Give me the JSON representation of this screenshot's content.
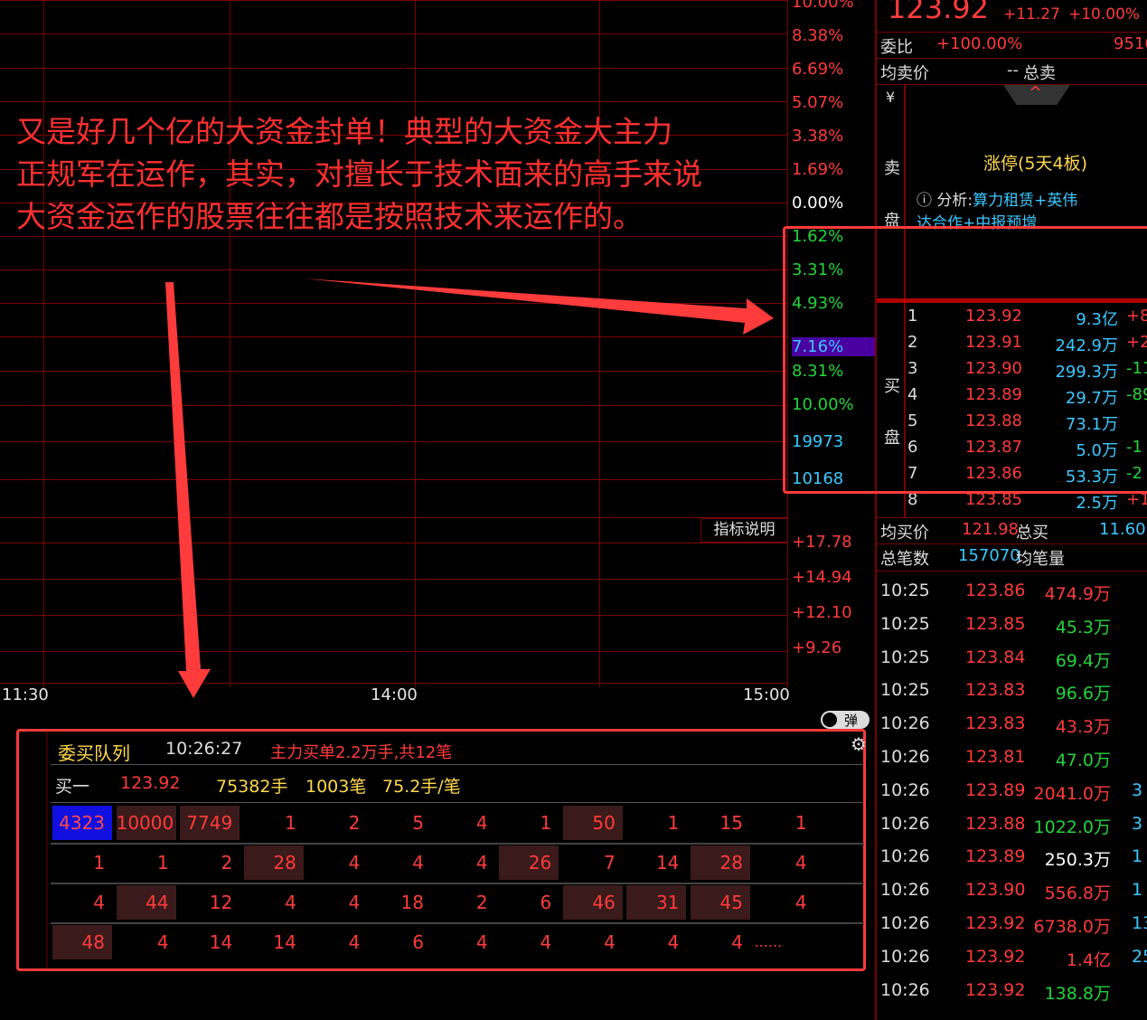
{
  "annotation": {
    "lines": [
      "又是好几个亿的大资金封单！典型的大资金大主力",
      "正规军在运作，其实，对擅长于技术面来的高手来说",
      "大资金运作的股票往往都是按照技术来运作的。"
    ]
  },
  "price_axis": [
    {
      "label": "10.00%",
      "color": "red"
    },
    {
      "label": "8.38%",
      "color": "red"
    },
    {
      "label": "6.69%",
      "color": "red"
    },
    {
      "label": "5.07%",
      "color": "red"
    },
    {
      "label": "3.38%",
      "color": "red"
    },
    {
      "label": "1.69%",
      "color": "red"
    },
    {
      "label": "0.00%",
      "color": "white"
    },
    {
      "label": "1.62%",
      "color": "green"
    },
    {
      "label": "3.31%",
      "color": "green"
    },
    {
      "label": "4.93%",
      "color": "green"
    },
    {
      "label": "7.16%",
      "color": "cyan"
    },
    {
      "label": "8.31%",
      "color": "green"
    },
    {
      "label": "10.00%",
      "color": "green"
    },
    {
      "label": "19973",
      "color": "cyan"
    },
    {
      "label": "10168",
      "color": "cyan"
    }
  ],
  "indicator_axis": [
    "+17.78",
    "+14.94",
    "+12.10",
    "+9.26"
  ],
  "time_axis": [
    "11:30",
    "14:00",
    "15:00"
  ],
  "indicator_button": "指标说明",
  "quote": {
    "price": "123.92",
    "change": "+11.27",
    "change_pct": "+10.00%",
    "wei_bi_label": "委比",
    "wei_bi_value": "+100.00%",
    "wei_bi_extra": "9510",
    "avg_sell_label": "均卖价",
    "avg_sell_value": "--",
    "total_sell_label": "总卖",
    "sell_label": "卖",
    "sell_label2": "盘",
    "limit_text": "涨停(5天4板)",
    "analysis_label": "分析:",
    "analysis_text": "算力租赁+英伟",
    "analysis_text2": "达合作+中报预增",
    "buy_label": "买",
    "buy_label2": "盘",
    "avg_buy_label": "均买价",
    "avg_buy_value": "121.98",
    "total_buy_label": "总买",
    "total_buy_value": "11.60",
    "total_trades_label": "总笔数",
    "total_trades_value": "157070",
    "avg_trade_label": "均笔量"
  },
  "buy_levels": [
    {
      "level": "1",
      "price": "123.92",
      "volume": "9.3亿",
      "delta": "+8"
    },
    {
      "level": "2",
      "price": "123.91",
      "volume": "242.9万",
      "delta": "+2"
    },
    {
      "level": "3",
      "price": "123.90",
      "volume": "299.3万",
      "delta": "-11"
    },
    {
      "level": "4",
      "price": "123.89",
      "volume": "29.7万",
      "delta": "-89"
    },
    {
      "level": "5",
      "price": "123.88",
      "volume": "73.1万",
      "delta": ""
    },
    {
      "level": "6",
      "price": "123.87",
      "volume": "5.0万",
      "delta": "-1"
    },
    {
      "level": "7",
      "price": "123.86",
      "volume": "53.3万",
      "delta": "-2"
    },
    {
      "level": "8",
      "price": "123.85",
      "volume": "2.5万",
      "delta": "+1"
    }
  ],
  "ticks": [
    {
      "time": "10:25",
      "price": "123.86",
      "amount": "474.9万",
      "amount_color": "red",
      "extra": ""
    },
    {
      "time": "10:25",
      "price": "123.85",
      "amount": "45.3万",
      "amount_color": "green",
      "extra": ""
    },
    {
      "time": "10:25",
      "price": "123.84",
      "amount": "69.4万",
      "amount_color": "green",
      "extra": ""
    },
    {
      "time": "10:25",
      "price": "123.83",
      "amount": "96.6万",
      "amount_color": "green",
      "extra": ""
    },
    {
      "time": "10:26",
      "price": "123.83",
      "amount": "43.3万",
      "amount_color": "red",
      "extra": ""
    },
    {
      "time": "10:26",
      "price": "123.81",
      "amount": "47.0万",
      "amount_color": "green",
      "extra": ""
    },
    {
      "time": "10:26",
      "price": "123.89",
      "amount": "2041.0万",
      "amount_color": "red",
      "extra": "3"
    },
    {
      "time": "10:26",
      "price": "123.88",
      "amount": "1022.0万",
      "amount_color": "green",
      "extra": "3"
    },
    {
      "time": "10:26",
      "price": "123.89",
      "amount": "250.3万",
      "amount_color": "white",
      "extra": "1"
    },
    {
      "time": "10:26",
      "price": "123.90",
      "amount": "556.8万",
      "amount_color": "red",
      "extra": "1"
    },
    {
      "time": "10:26",
      "price": "123.92",
      "amount": "6738.0万",
      "amount_color": "red",
      "extra": "13"
    },
    {
      "time": "10:26",
      "price": "123.92",
      "amount": "1.4亿",
      "amount_color": "red",
      "extra": "25"
    },
    {
      "time": "10:26",
      "price": "123.92",
      "amount": "138.8万",
      "amount_color": "green",
      "extra": ""
    }
  ],
  "queue": {
    "title": "委买队列",
    "time": "10:26:27",
    "summary": "主力买单2.2万手,共12笔",
    "buy_one_label": "买一",
    "buy_one_price": "123.92",
    "buy_one_hands": "75382手",
    "buy_one_count": "1003笔",
    "buy_one_avg": "75.2手/笔",
    "toggle_label": "弹",
    "rows": [
      [
        "4323",
        "10000",
        "7749",
        "1",
        "2",
        "5",
        "4",
        "1",
        "50",
        "1",
        "15",
        "1"
      ],
      [
        "1",
        "1",
        "2",
        "28",
        "4",
        "4",
        "4",
        "26",
        "7",
        "14",
        "28",
        "4"
      ],
      [
        "4",
        "44",
        "12",
        "4",
        "4",
        "18",
        "2",
        "6",
        "46",
        "31",
        "45",
        "4"
      ],
      [
        "48",
        "4",
        "14",
        "14",
        "4",
        "6",
        "4",
        "4",
        "4",
        "4",
        "4",
        "......"
      ]
    ],
    "highlight": [
      [
        1,
        1,
        1,
        0,
        0,
        0,
        0,
        0,
        1,
        0,
        0,
        0
      ],
      [
        0,
        0,
        0,
        1,
        0,
        0,
        0,
        1,
        0,
        0,
        1,
        0
      ],
      [
        0,
        1,
        0,
        0,
        0,
        0,
        0,
        0,
        1,
        1,
        1,
        0
      ],
      [
        1,
        0,
        0,
        0,
        0,
        0,
        0,
        0,
        0,
        0,
        0,
        0
      ]
    ]
  }
}
